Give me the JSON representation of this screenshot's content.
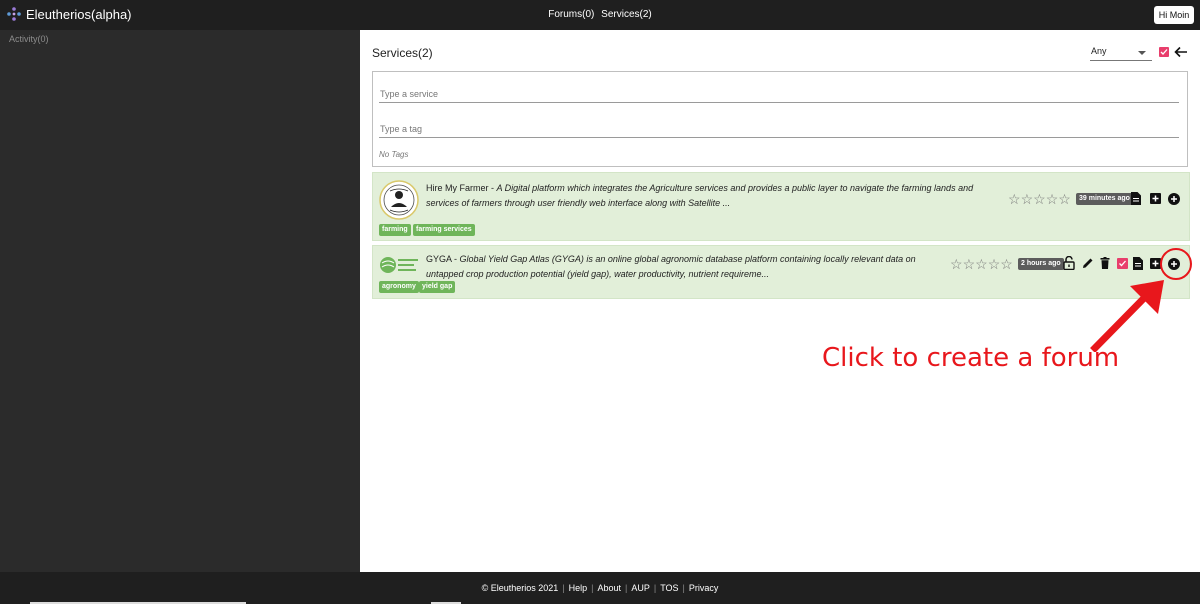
{
  "header": {
    "app_title": "Eleutherios(alpha)",
    "nav_forums": "Forums(0)",
    "nav_services": "Services(2)",
    "user_button": "Hi Moin"
  },
  "sidebar": {
    "activity_label": "Activity(0)"
  },
  "main": {
    "title": "Services(2)",
    "filter": {
      "selected": "Any"
    },
    "search": {
      "service_placeholder": "Type a service",
      "tag_placeholder": "Type a tag",
      "no_tags": "No Tags"
    },
    "services": [
      {
        "name": "Hire My Farmer",
        "separator": " - ",
        "description": "A Digital platform which integrates the Agriculture services and provides a public layer to navigate the farming lands and services of farmers through user friendly web interface along with Satellite ...",
        "tags": [
          "farming",
          "farming services"
        ],
        "rating": 0,
        "time": "39 minutes ago",
        "icons": [
          "document-icon",
          "plus-box-icon",
          "plus-circle-icon"
        ]
      },
      {
        "name": "GYGA",
        "separator": " - ",
        "description": "Global Yield Gap Atlas (GYGA) is an online global agronomic database platform containing locally relevant data on untapped crop production potential (yield gap), water productivity, nutrient requireme...",
        "tags": [
          "agronomy",
          "yield gap"
        ],
        "rating": 0,
        "time": "2 hours ago",
        "icons": [
          "unlock-icon",
          "pencil-icon",
          "trash-icon",
          "checkbox-icon",
          "document-icon",
          "plus-box-icon",
          "plus-circle-icon"
        ]
      }
    ]
  },
  "annotation": {
    "text": "Click to create a forum"
  },
  "footer": {
    "copyright": "© Eleutherios 2021",
    "links": [
      "Help",
      "About",
      "AUP",
      "TOS",
      "Privacy"
    ]
  },
  "colors": {
    "accent_pink": "#e83e6c",
    "card_bg": "#e2efd9",
    "tag_green": "#6fb55a",
    "annotation_red": "#e8171c",
    "topbar": "#1f1f1f"
  }
}
